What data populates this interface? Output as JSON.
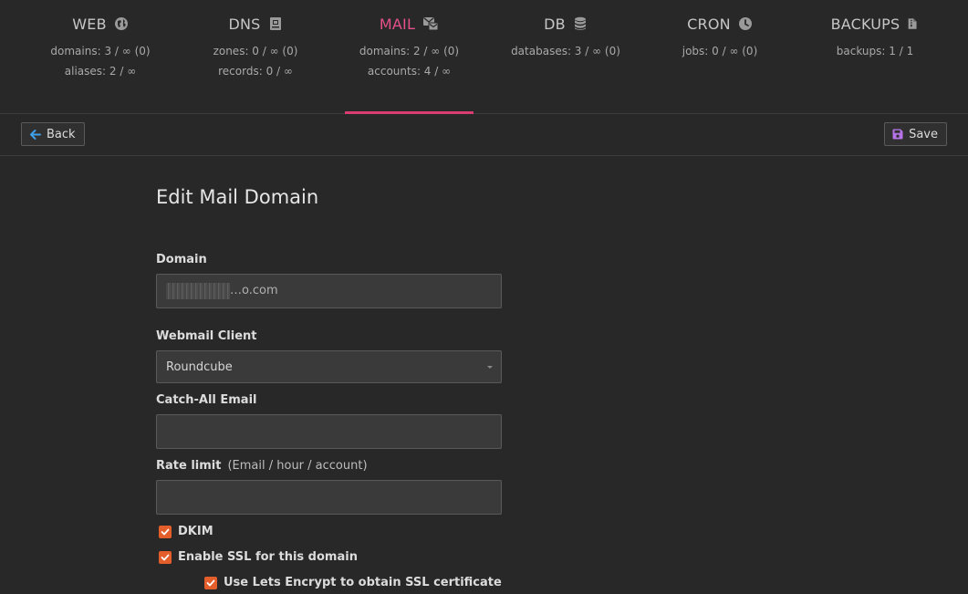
{
  "nav": {
    "tabs": [
      {
        "id": "web",
        "label": "WEB",
        "icon": "globe-icon",
        "stats": [
          "domains: 3 / ∞ (0)",
          "aliases: 2 / ∞"
        ]
      },
      {
        "id": "dns",
        "label": "DNS",
        "icon": "book-icon",
        "stats": [
          "zones: 0 / ∞ (0)",
          "records: 0 / ∞"
        ]
      },
      {
        "id": "mail",
        "label": "MAIL",
        "icon": "mail-icon",
        "stats": [
          "domains: 2 / ∞ (0)",
          "accounts: 4 / ∞"
        ],
        "active": true
      },
      {
        "id": "db",
        "label": "DB",
        "icon": "database-icon",
        "stats": [
          "databases: 3 / ∞ (0)"
        ]
      },
      {
        "id": "cron",
        "label": "CRON",
        "icon": "clock-icon",
        "stats": [
          "jobs: 0 / ∞ (0)"
        ]
      },
      {
        "id": "backups",
        "label": "BACKUPS",
        "icon": "file-archive-icon",
        "stats": [
          "backups: 1 / 1"
        ]
      }
    ]
  },
  "toolbar": {
    "back_label": "Back",
    "save_label": "Save"
  },
  "form": {
    "title": "Edit Mail Domain",
    "domain_label": "Domain",
    "domain_value": "…o.com",
    "webmail_label": "Webmail Client",
    "webmail_value": "Roundcube",
    "catchall_label": "Catch-All Email",
    "catchall_value": "",
    "ratelimit_label": "Rate limit",
    "ratelimit_hint": "(Email / hour / account)",
    "ratelimit_value": "",
    "dkim_label": "DKIM",
    "ssl_label": "Enable SSL for this domain",
    "letsencrypt_label": "Use Lets Encrypt to obtain SSL certificate"
  },
  "colors": {
    "accent": "#e5508a",
    "active_bar": "#d83c70",
    "checkbox": "#e35e2a",
    "save_icon": "#b673e8",
    "back_icon": "#3f9fe8"
  }
}
